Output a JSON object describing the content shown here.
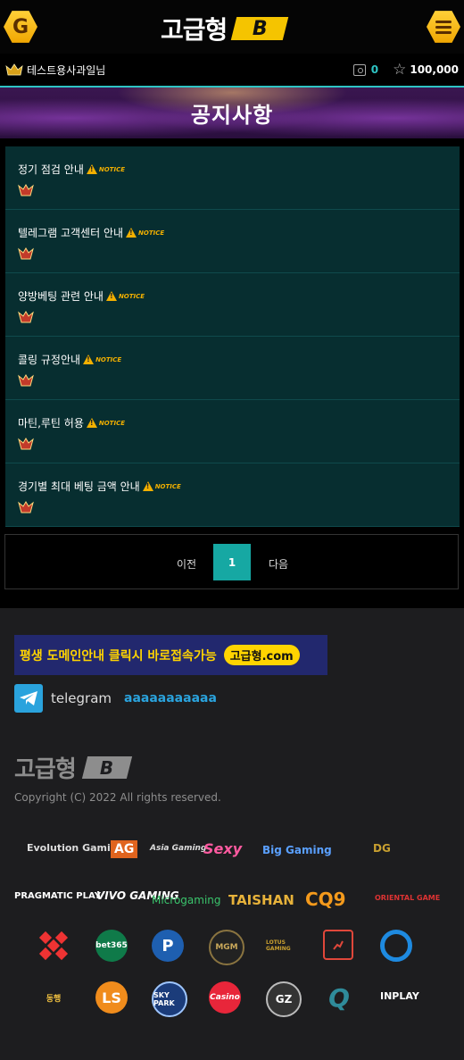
{
  "header": {
    "left_icon": "g-hex-icon",
    "left_letter": "G",
    "logo_text": "고급형",
    "logo_badge": "B",
    "menu_icon": "hamburger-icon"
  },
  "userbar": {
    "username": "테스트용사과일님",
    "coin": "0",
    "points": "100,000"
  },
  "page_title": "공지사항",
  "notices": [
    {
      "title": "정기 점검 안내",
      "tag": "NOTICE"
    },
    {
      "title": "텔레그램 고객센터 안내",
      "tag": "NOTICE"
    },
    {
      "title": "양방베팅 관련 안내",
      "tag": "NOTICE"
    },
    {
      "title": "콜링 규정안내",
      "tag": "NOTICE"
    },
    {
      "title": "마틴,루틴 허용",
      "tag": "NOTICE"
    },
    {
      "title": "경기별 최대 베팅 금액 안내",
      "tag": "NOTICE"
    }
  ],
  "pagination": {
    "prev": "이전",
    "current": "1",
    "next": "다음"
  },
  "footer": {
    "domain_banner_text": "평생 도메인안내 클릭시 바로접속가능",
    "domain_banner_pill": "고급형.com",
    "telegram_label": "telegram",
    "telegram_id": "aaaaaaaaaaa",
    "logo_text": "고급형",
    "logo_badge": "B",
    "copyright": "Copyright (C) 2022 All rights reserved."
  },
  "providers": {
    "evolution": "Evolution Gaming",
    "ag": "AG",
    "ag_sub": "Asia Gaming",
    "sexy": "Sexy",
    "big": "Big Gaming",
    "dragon": "DG",
    "pragmatic": "PRAGMATIC PLAY",
    "vivo": "VIVO GAMING",
    "micro": "Microgaming",
    "taishan": "TAISHAN",
    "cq9": "CQ9",
    "oriental": "ORIENTAL GAME",
    "bet365": "bet365",
    "p": "P",
    "mgm": "MGM",
    "lotus": "LOTUS GAMING",
    "ls": "LS",
    "sky": "SKY PARK",
    "casino": "Casino",
    "gz": "GZ",
    "inplay": "INPLAY",
    "donghaeng": "동행"
  }
}
